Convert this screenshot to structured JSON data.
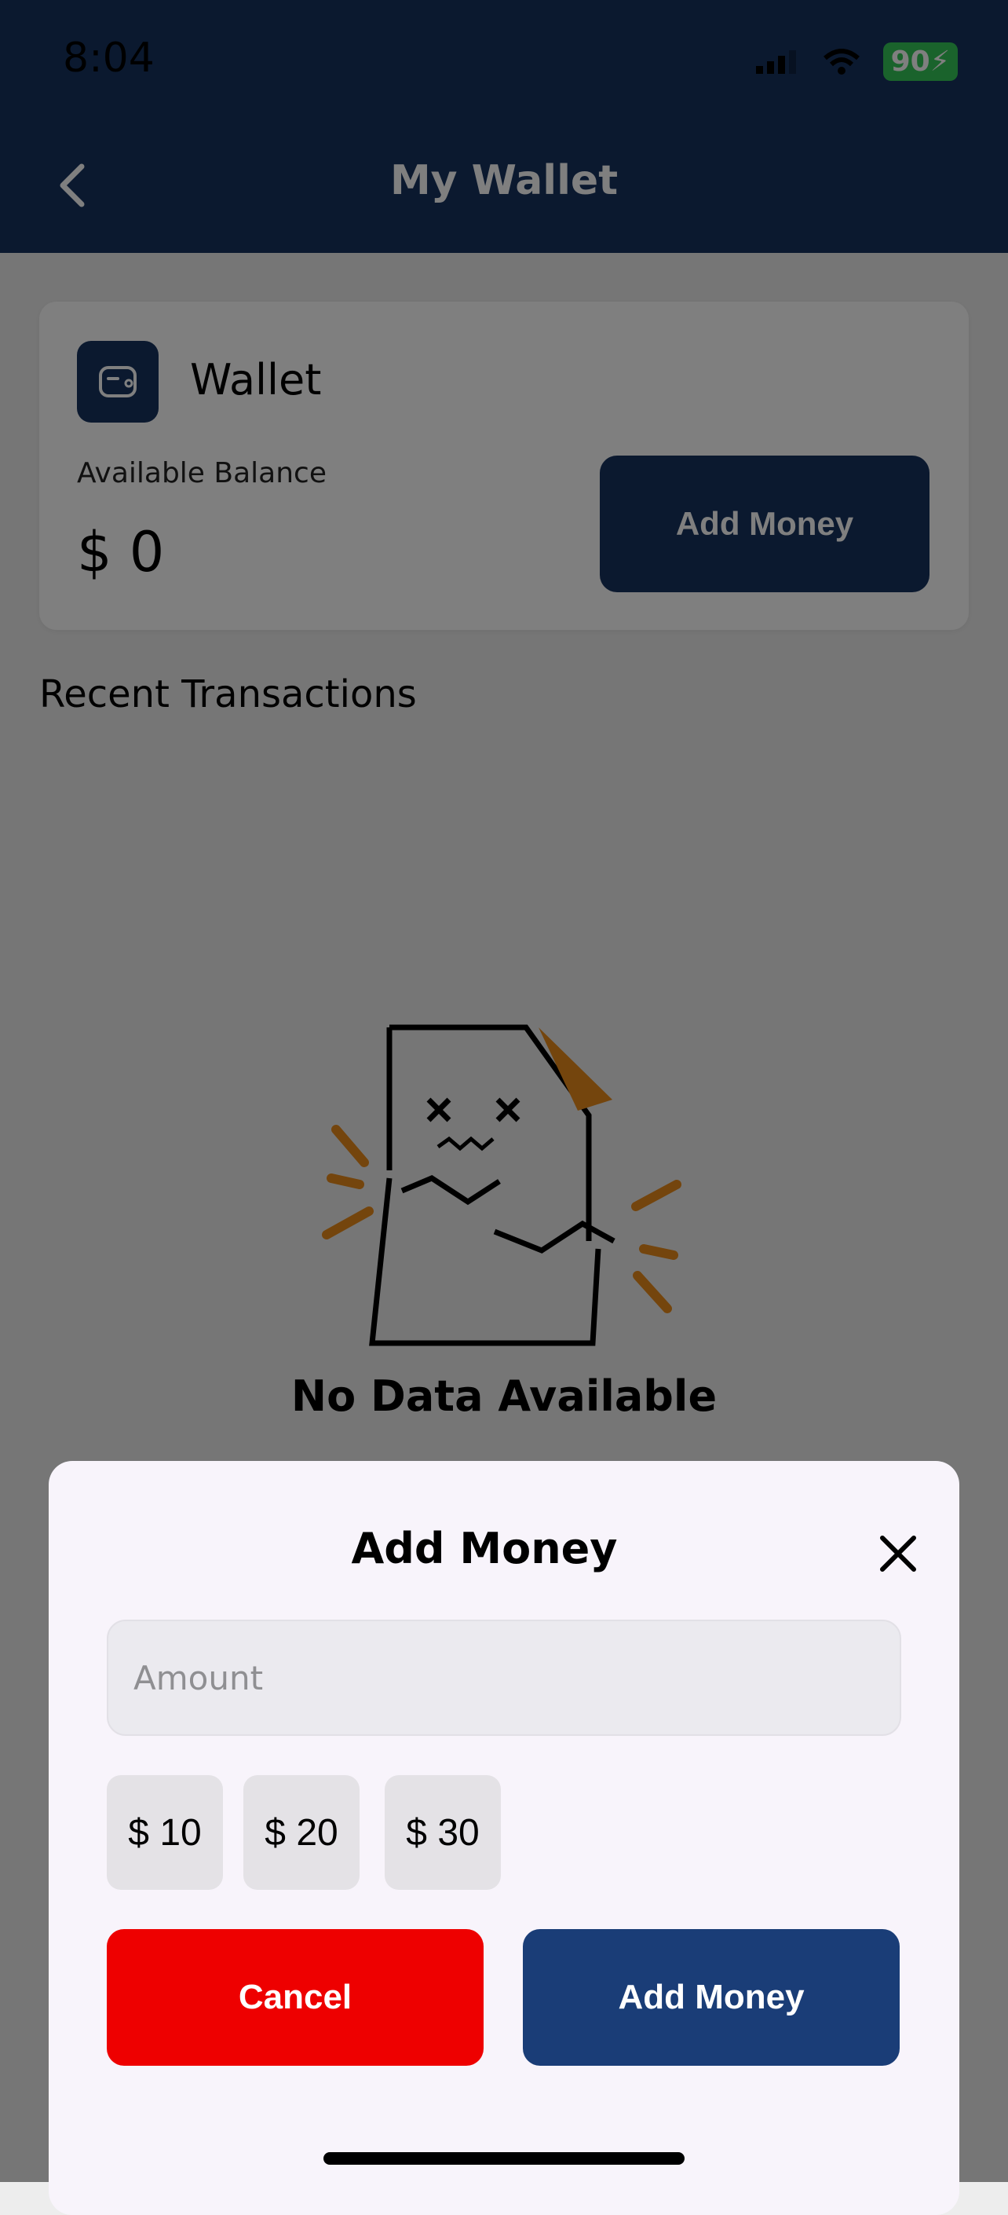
{
  "status_bar": {
    "time": "8:04",
    "battery": "90"
  },
  "header": {
    "title": "My Wallet"
  },
  "wallet_card": {
    "title": "Wallet",
    "available_label": "Available Balance",
    "balance": "$ 0",
    "add_money_label": "Add Money"
  },
  "recent": {
    "heading": "Recent Transactions"
  },
  "empty_state": {
    "text": "No Data Available"
  },
  "modal": {
    "title": "Add Money",
    "amount_placeholder": "Amount",
    "presets": [
      "$ 10",
      "$ 20",
      "$ 30"
    ],
    "cancel_label": "Cancel",
    "add_label": "Add Money"
  },
  "colors": {
    "brand": "#16325f",
    "cancel": "#ee0000",
    "illustration_accent": "#e88a1a"
  }
}
